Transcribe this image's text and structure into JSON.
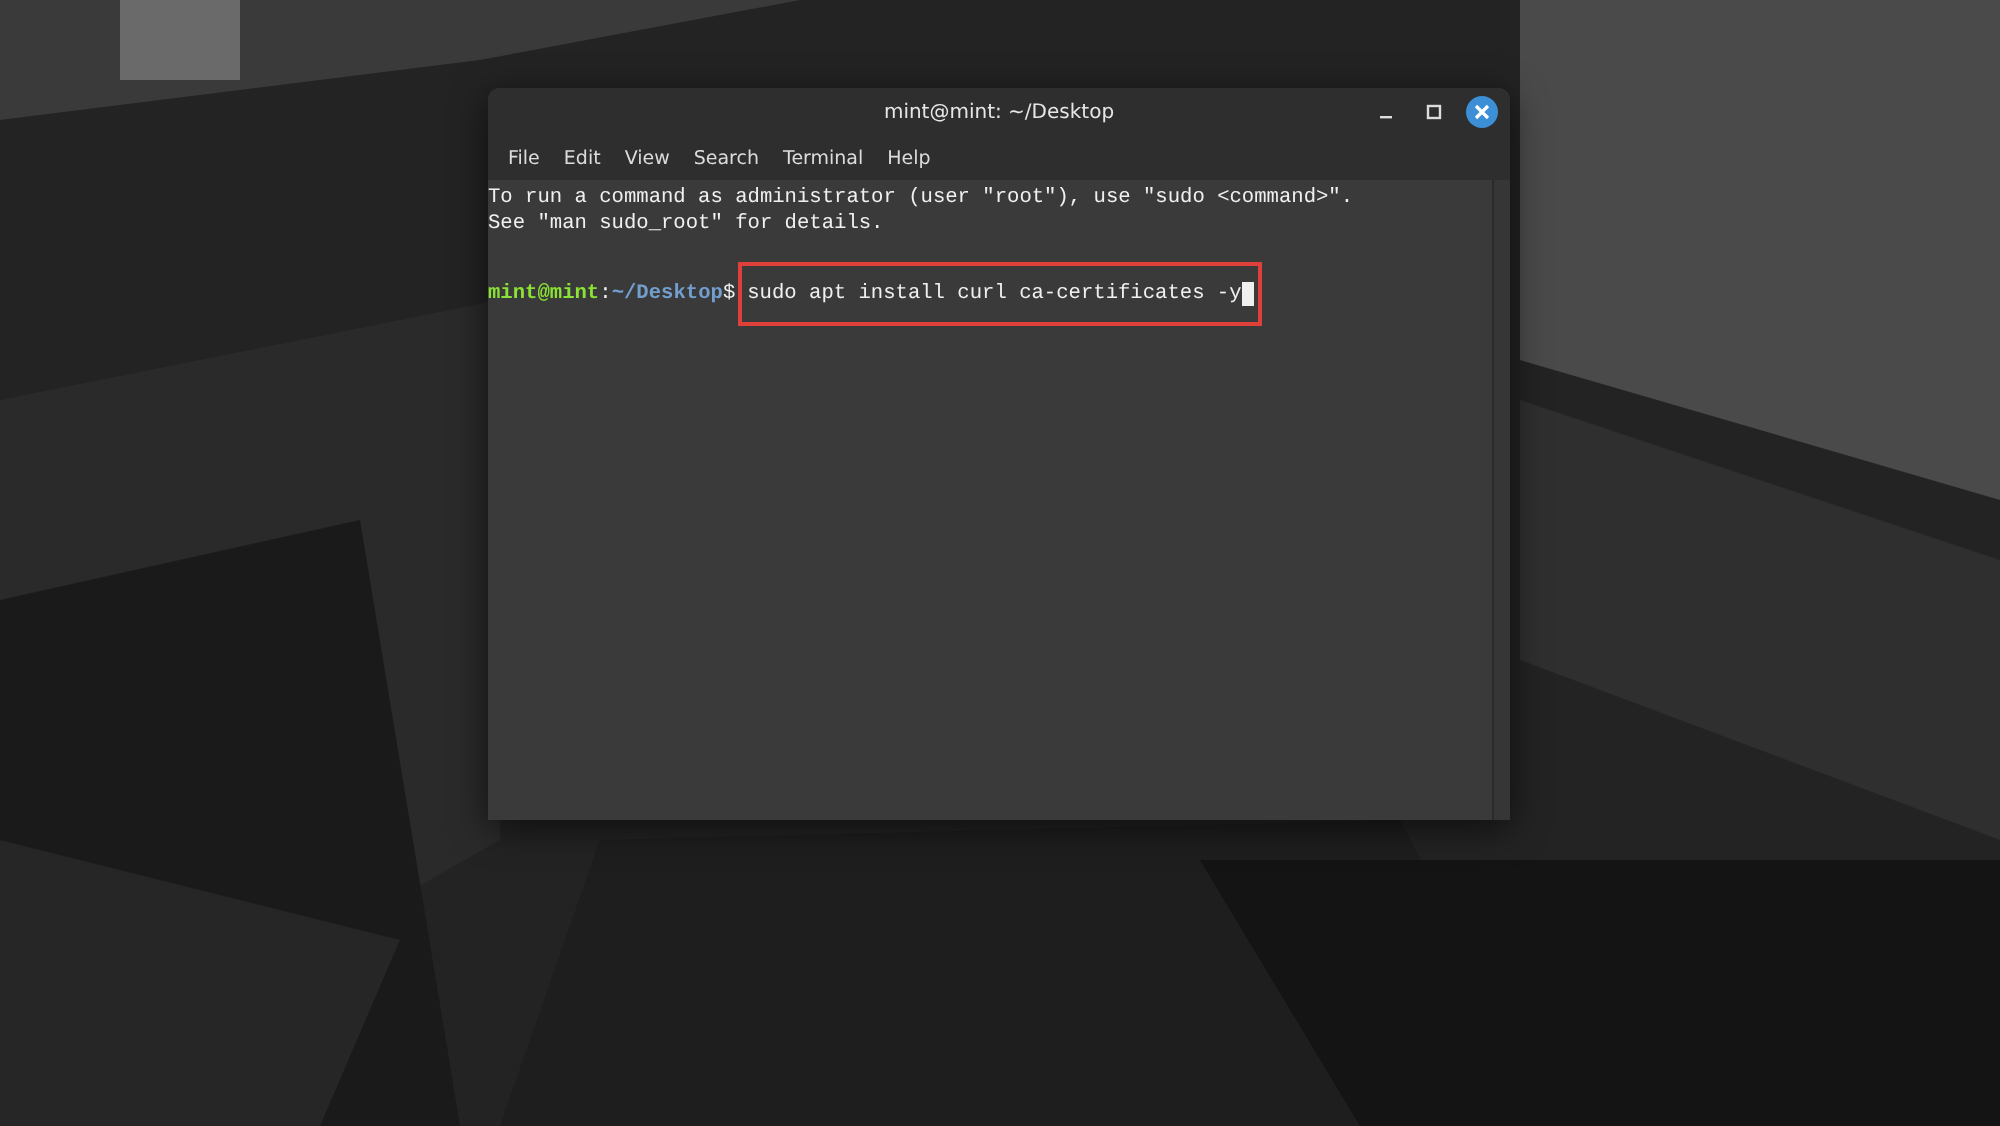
{
  "window": {
    "title": "mint@mint: ~/Desktop"
  },
  "menu": [
    "File",
    "Edit",
    "View",
    "Search",
    "Terminal",
    "Help"
  ],
  "output_lines": [
    "To run a command as administrator (user \"root\"), use \"sudo <command>\".",
    "See \"man sudo_root\" for details."
  ],
  "prompt": {
    "user_host": "mint@mint",
    "separator": ":",
    "path": "~/Desktop",
    "symbol": "$"
  },
  "command": {
    "text": "sudo apt install curl ca-certificates -y",
    "highlighted": true,
    "cursor": true
  }
}
